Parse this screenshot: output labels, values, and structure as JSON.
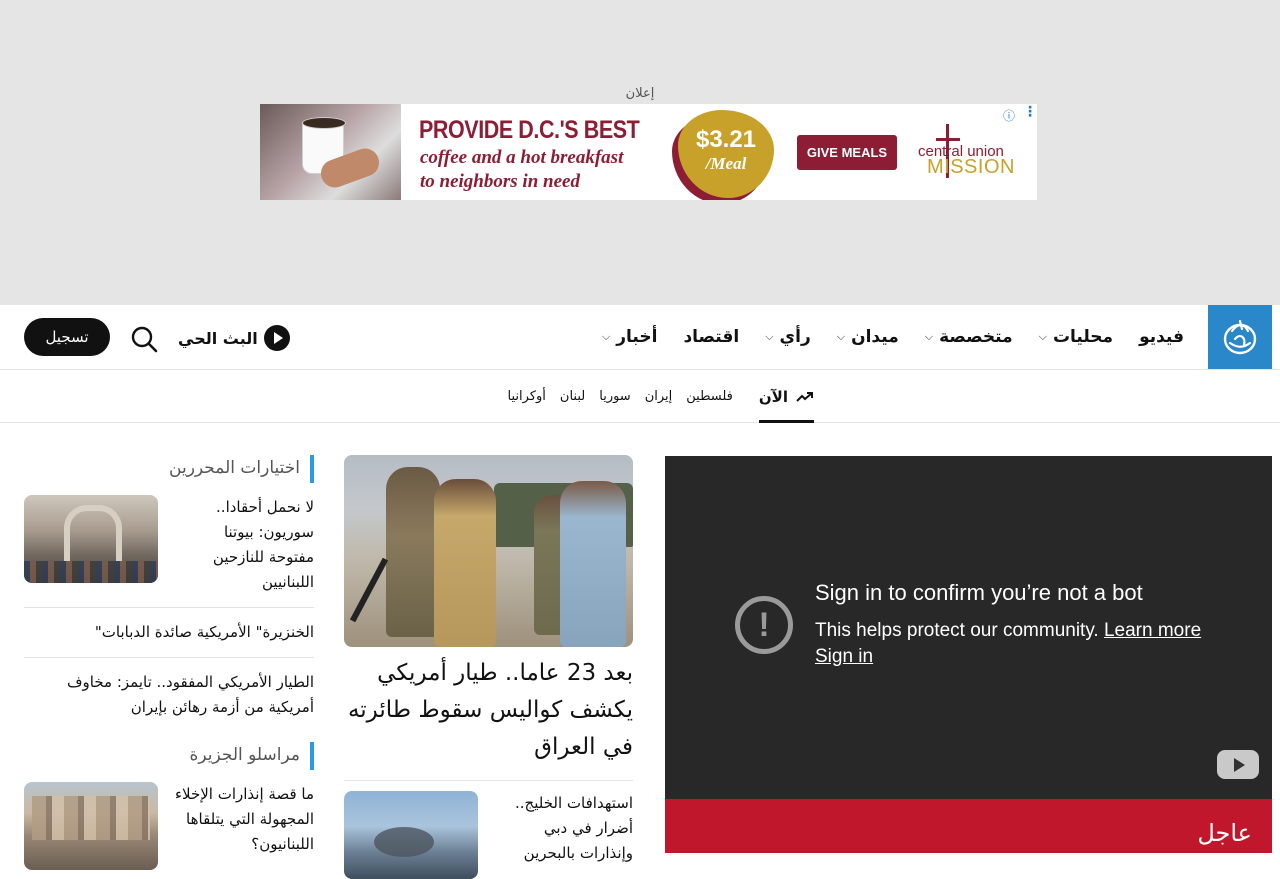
{
  "ad": {
    "label": "إعلان",
    "headline": "PROVIDE D.C.'S BEST",
    "sub_line1": "coffee and a hot breakfast",
    "sub_line2": "to neighbors in need",
    "price": "$3.21",
    "per": "/Meal",
    "cta": "GIVE MEALS",
    "brand_line1": "central union",
    "brand_line2": "MISSION",
    "colors": {
      "maroon": "#8c1d34",
      "gold": "#c8a12a"
    }
  },
  "header": {
    "logo_icon": "aljazeera-logo",
    "nav": [
      {
        "label": "أخبار",
        "dropdown": true
      },
      {
        "label": "اقتصاد",
        "dropdown": false
      },
      {
        "label": "رأي",
        "dropdown": true
      },
      {
        "label": "ميدان",
        "dropdown": true
      },
      {
        "label": "متخصصة",
        "dropdown": true
      },
      {
        "label": "محليات",
        "dropdown": true
      },
      {
        "label": "فيديو",
        "dropdown": false
      }
    ],
    "live_label": "البث الحي",
    "register_label": "تسجيل",
    "accent": "#2a87c9"
  },
  "trending": {
    "now_label": "الآن",
    "items": [
      "فلسطين",
      "إيران",
      "سوريا",
      "لبنان",
      "أوكرانيا"
    ]
  },
  "sidebar": {
    "editors_title": "اختيارات المحررين",
    "story1": "لا نحمل أحقادا.. سوريون: بيوتنا مفتوحة للنازحين اللبنانيين",
    "story2": "\"الخنزيرة\" الأمريكية صائدة الدبابات",
    "story3": "الطيار الأمريكي المفقود.. تايمز: مخاوف أمريكية من أزمة رهائن بإيران",
    "correspondents_title": "مراسلو الجزيرة",
    "story4": "ما قصة إنذارات الإخلاء المجهولة التي يتلقاها اللبنانيون؟"
  },
  "main": {
    "headline": "بعد 23 عاما.. طيار أمريكي يكشف كواليس سقوط طائرته في العراق",
    "story2": "استهدافات الخليج.. أضرار في دبي وإنذارات بالبحرين"
  },
  "video": {
    "title": "Sign in to confirm you’re not a bot",
    "help": "This helps protect our community.",
    "learn_more": "Learn more",
    "sign_in": "Sign in"
  },
  "urgent": {
    "label": "عاجل",
    "color": "#c1172c"
  }
}
